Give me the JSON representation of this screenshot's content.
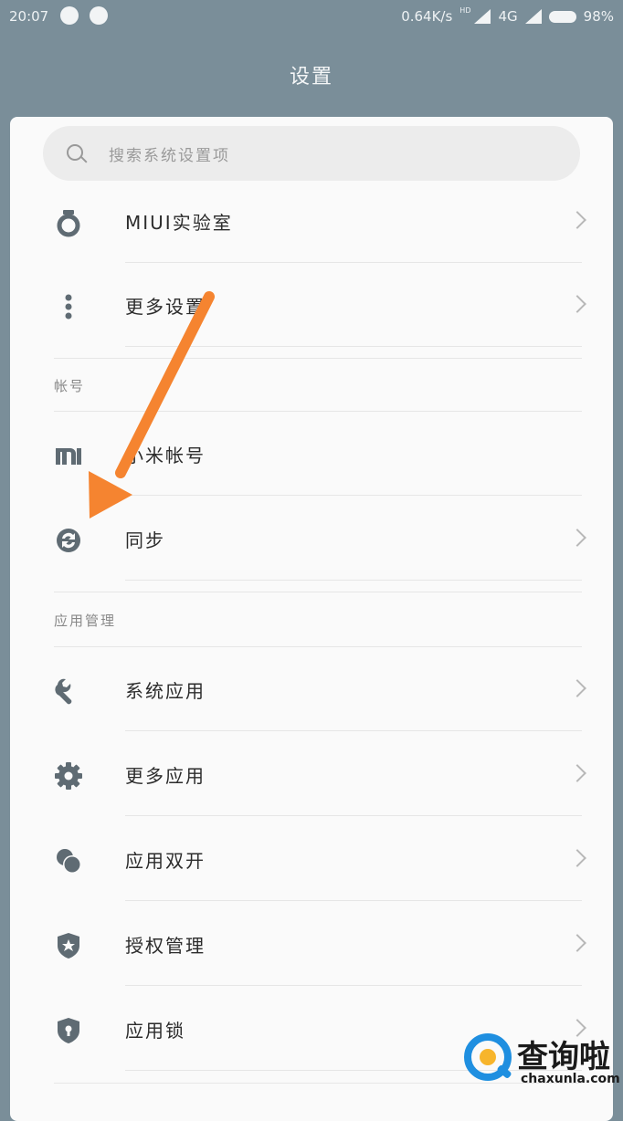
{
  "status": {
    "time": "20:07",
    "speed": "0.64K/s",
    "hd": "HD",
    "net": "4G",
    "battery": "98%"
  },
  "page": {
    "title": "设置"
  },
  "search": {
    "placeholder": "搜索系统设置项"
  },
  "rows_top": [
    {
      "label": "MIUI实验室",
      "icon": "lab-flask-icon"
    },
    {
      "label": "更多设置",
      "icon": "more-dots-icon"
    }
  ],
  "sections": [
    {
      "title": "帐号",
      "items": [
        {
          "label": "小米帐号",
          "icon": "mi-logo-icon"
        },
        {
          "label": "同步",
          "icon": "sync-icon"
        }
      ]
    },
    {
      "title": "应用管理",
      "items": [
        {
          "label": "系统应用",
          "icon": "wrench-icon"
        },
        {
          "label": "更多应用",
          "icon": "gear-icon"
        },
        {
          "label": "应用双开",
          "icon": "dual-app-icon"
        },
        {
          "label": "授权管理",
          "icon": "shield-star-icon"
        },
        {
          "label": "应用锁",
          "icon": "lock-shield-icon"
        }
      ]
    }
  ],
  "watermark": {
    "name": "查询啦",
    "site": "chaxunla.com"
  },
  "colors": {
    "header_bg": "#7a8e99",
    "arrow": "#f58430",
    "icon": "#5f6b73"
  }
}
